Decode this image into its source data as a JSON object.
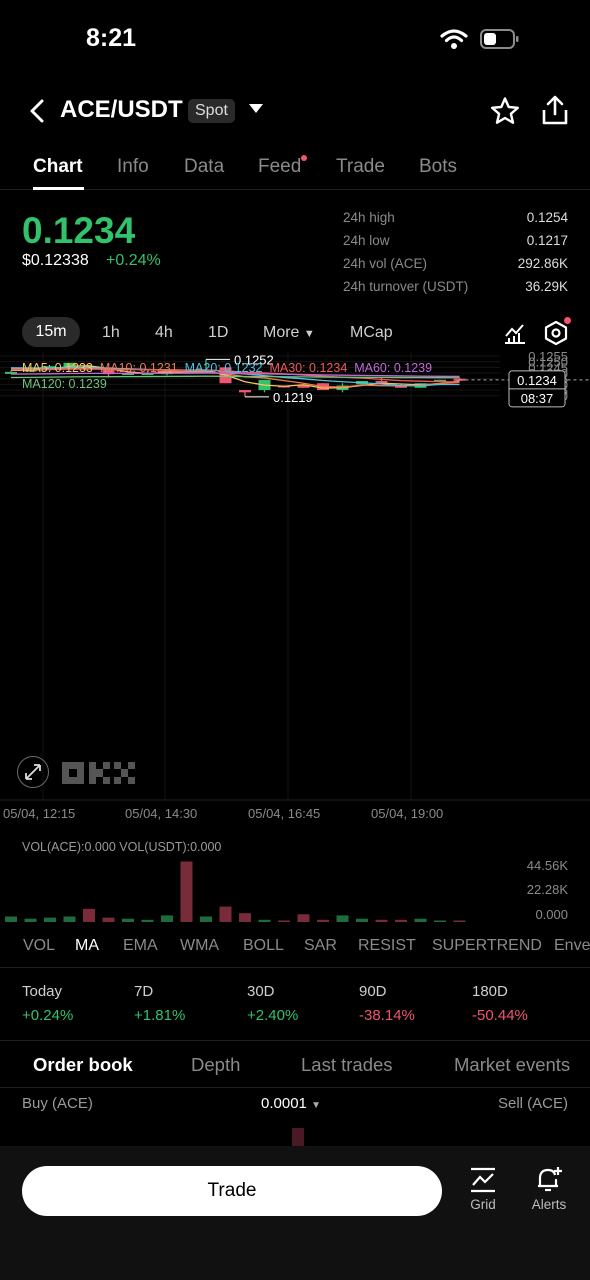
{
  "status_bar": {
    "time": "8:21"
  },
  "header": {
    "pair": "ACE/USDT",
    "badge": "Spot"
  },
  "tabs": [
    {
      "label": "Chart",
      "active": true
    },
    {
      "label": "Info"
    },
    {
      "label": "Data"
    },
    {
      "label": "Feed"
    },
    {
      "label": "Trade"
    },
    {
      "label": "Bots"
    }
  ],
  "price": {
    "last": "0.1234",
    "usd": "$0.12338",
    "change": "+0.24%"
  },
  "stats": [
    {
      "label": "24h high",
      "value": "0.1254"
    },
    {
      "label": "24h low",
      "value": "0.1217"
    },
    {
      "label": "24h vol (ACE)",
      "value": "292.86K"
    },
    {
      "label": "24h turnover (USDT)",
      "value": "36.29K"
    }
  ],
  "intervals": [
    "15m",
    "1h",
    "4h",
    "1D",
    "More",
    "MCap"
  ],
  "ma_legend": {
    "ma5": "MA5: 0.1233",
    "ma10": "MA10: 0.1231",
    "ma20": "MA20: 0.1232",
    "ma30": "MA30: 0.1234",
    "ma60": "MA60: 0.1239",
    "ma120": "MA120: 0.1239"
  },
  "colors": {
    "up": "#31c26b",
    "down": "#f05670",
    "ma5": "#f7c75a",
    "ma10": "#f07a4e",
    "ma20": "#4fc3e8",
    "ma30": "#f05a5a",
    "ma60": "#c06ad8",
    "ma120": "#6ec27a"
  },
  "chart_data": {
    "type": "candlestick",
    "y_ticks": [
      "0.1255",
      "0.1250",
      "0.1245",
      "0.1240",
      "0.1235",
      "0.1230",
      "0.1225",
      "0.1220"
    ],
    "x_ticks": [
      "05/04, 12:15",
      "05/04, 14:30",
      "05/04, 16:45",
      "05/04, 19:00"
    ],
    "high_label": "0.1252",
    "low_label": "0.1219",
    "last_price_label": "0.1234",
    "countdown": "08:37",
    "candles": [
      [
        0.1241,
        0.1242,
        0.124,
        0.1241
      ],
      [
        0.1242,
        0.1243,
        0.1241,
        0.1243
      ],
      [
        0.1243,
        0.1244,
        0.1242,
        0.1246
      ],
      [
        0.1246,
        0.1247,
        0.1245,
        0.1249
      ],
      [
        0.1246,
        0.1246,
        0.1243,
        0.1244
      ],
      [
        0.1245,
        0.1245,
        0.1236,
        0.1239
      ],
      [
        0.124,
        0.124,
        0.1239,
        0.124
      ],
      [
        0.1239,
        0.1242,
        0.1239,
        0.124
      ],
      [
        0.1239,
        0.1243,
        0.1238,
        0.1242
      ],
      [
        0.1242,
        0.1242,
        0.124,
        0.1241
      ],
      [
        0.1242,
        0.1252,
        0.1241,
        0.1243
      ],
      [
        0.1245,
        0.1245,
        0.1231,
        0.1231
      ],
      [
        0.1225,
        0.1225,
        0.1219,
        0.1223
      ],
      [
        0.1225,
        0.1234,
        0.1223,
        0.1234
      ],
      [
        0.1229,
        0.1229,
        0.1227,
        0.1228
      ],
      [
        0.1229,
        0.1229,
        0.1227,
        0.1227
      ],
      [
        0.1231,
        0.1231,
        0.1225,
        0.1225
      ],
      [
        0.1225,
        0.1231,
        0.1223,
        0.1229
      ],
      [
        0.123,
        0.1233,
        0.1229,
        0.1233
      ],
      [
        0.1233,
        0.1236,
        0.1231,
        0.1231
      ],
      [
        0.1229,
        0.123,
        0.1227,
        0.1227
      ],
      [
        0.1227,
        0.1231,
        0.1227,
        0.1231
      ],
      [
        0.1233,
        0.1234,
        0.1233,
        0.1234
      ],
      [
        0.1235,
        0.1236,
        0.1234,
        0.1234
      ]
    ],
    "volume_ticks": [
      "44.56K",
      "22.28K",
      "0.000"
    ],
    "volume": [
      0.5,
      0.3,
      0.4,
      0.5,
      1.2,
      0.4,
      0.3,
      0.2,
      0.6,
      5.5,
      0.5,
      1.4,
      0.8,
      0.2,
      0.1,
      0.7,
      0.2,
      0.6,
      0.3,
      0.2,
      0.2,
      0.3,
      0.1,
      0.1
    ]
  },
  "vol_label": "VOL(ACE):0.000  VOL(USDT):0.000",
  "indicators": [
    "VOL",
    "MA",
    "EMA",
    "WMA",
    "BOLL",
    "SAR",
    "RESIST",
    "SUPERTREND",
    "Enve"
  ],
  "performance": [
    {
      "label": "Today",
      "value": "+0.24%"
    },
    {
      "label": "7D",
      "value": "+1.81%"
    },
    {
      "label": "30D",
      "value": "+2.40%"
    },
    {
      "label": "90D",
      "value": "-38.14%"
    },
    {
      "label": "180D",
      "value": "-50.44%"
    }
  ],
  "order_book": {
    "tabs": [
      "Order book",
      "Depth",
      "Last trades",
      "Market events"
    ],
    "buy_label": "Buy (ACE)",
    "step": "0.0001",
    "sell_label": "Sell (ACE)"
  },
  "bottom": {
    "trade": "Trade",
    "grid": "Grid",
    "alerts": "Alerts"
  }
}
